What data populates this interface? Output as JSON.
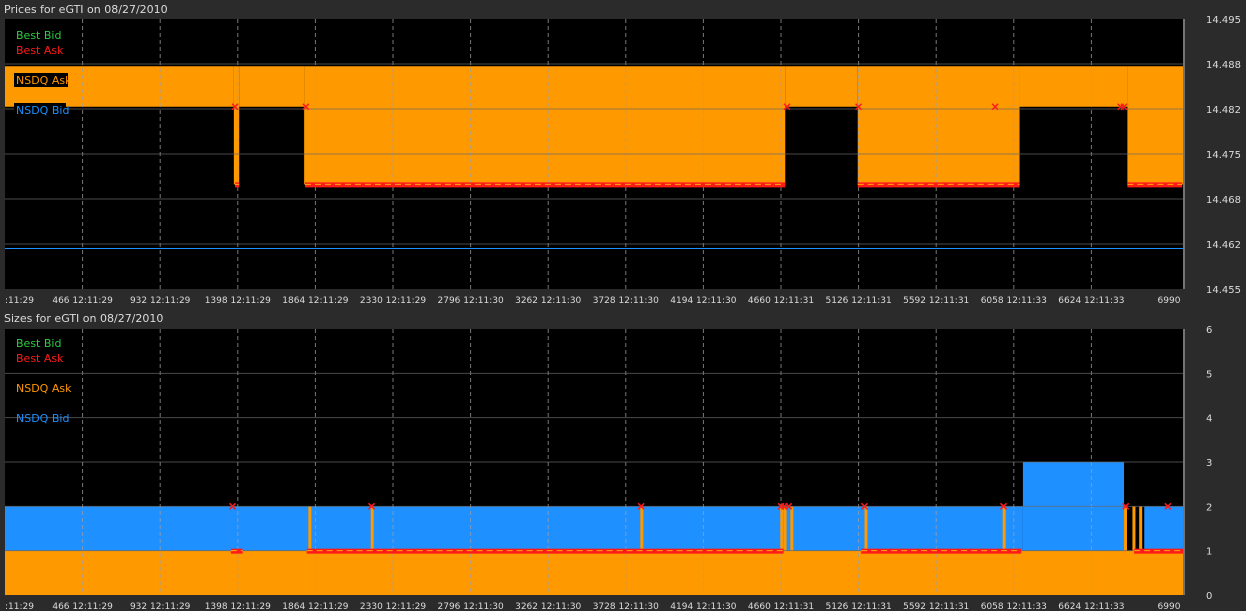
{
  "colors": {
    "background": "#2b2b2b",
    "plot_bg": "#000000",
    "best_bid": "#2ecc40",
    "best_ask": "#ff1a1a",
    "nsdq_ask": "#ff9900",
    "nsdq_bid": "#1e90ff",
    "grid": "#808080",
    "text": "#dcdcdc"
  },
  "chart_data": [
    {
      "type": "area",
      "title": "Prices for  eGTI  on  08/27/2010",
      "legend_position": "top-left",
      "legend": [
        "Best Bid",
        "Best Ask",
        "NSDQ Ask",
        "NSDQ Bid"
      ],
      "x_tick_labels": [
        ":11:29",
        "466 12:11:29",
        "932 12:11:29",
        "1398 12:11:29",
        "1864 12:11:29",
        "2330 12:11:29",
        "2796 12:11:30",
        "3262 12:11:30",
        "3728 12:11:30",
        "4194 12:11:30",
        "4660 12:11:31",
        "5126 12:11:31",
        "5592 12:11:31",
        "6058 12:11:33",
        "6624 12:11:33",
        "6990"
      ],
      "y_tick_labels": [
        "14.495",
        "14.488",
        "14.482",
        "14.475",
        "14.468",
        "14.462",
        "14.455"
      ],
      "xlim": [
        0,
        6990
      ],
      "ylim": [
        14.455,
        14.495
      ],
      "grid": true,
      "nsdq_ask_level": 14.488,
      "nsdq_bid_segments": [
        {
          "x0": 0,
          "x1": 1358,
          "y": 14.482
        },
        {
          "x0": 1358,
          "x1": 1390,
          "y": 14.4705
        },
        {
          "x0": 1390,
          "x1": 1775,
          "y": 14.482
        },
        {
          "x0": 1775,
          "x1": 4630,
          "y": 14.4705
        },
        {
          "x0": 4630,
          "x1": 5060,
          "y": 14.482
        },
        {
          "x0": 5060,
          "x1": 6020,
          "y": 14.4705
        },
        {
          "x0": 6020,
          "x1": 6660,
          "y": 14.482
        },
        {
          "x0": 6660,
          "x1": 6990,
          "y": 14.4705
        }
      ],
      "best_bid_line": 14.461,
      "best_ask_markers": [
        1365,
        1785,
        4640,
        5065,
        5875,
        6620,
        6640
      ],
      "best_ask_runs": [
        {
          "x0": 1365,
          "x1": 1390,
          "y": 14.4705
        },
        {
          "x0": 1780,
          "x1": 4630,
          "y": 14.4705
        },
        {
          "x0": 5060,
          "x1": 6020,
          "y": 14.4705
        },
        {
          "x0": 6660,
          "x1": 6985,
          "y": 14.4705
        }
      ]
    },
    {
      "type": "area",
      "title": "Sizes for  eGTI  on  08/27/2010",
      "legend_position": "top-left",
      "legend": [
        "Best Bid",
        "Best Ask",
        "NSDQ Ask",
        "NSDQ Bid"
      ],
      "x_tick_labels": [
        ":11:29",
        "466 12:11:29",
        "932 12:11:29",
        "1398 12:11:29",
        "1864 12:11:29",
        "2330 12:11:29",
        "2796 12:11:30",
        "3262 12:11:30",
        "3728 12:11:30",
        "4194 12:11:30",
        "4660 12:11:31",
        "5126 12:11:31",
        "5592 12:11:31",
        "6058 12:11:33",
        "6624 12:11:33",
        "6990"
      ],
      "y_tick_labels": [
        "6",
        "5",
        "4",
        "3",
        "2",
        "1",
        "0"
      ],
      "xlim": [
        0,
        6990
      ],
      "ylim": [
        0,
        6
      ],
      "grid": true,
      "nsdq_ask_size": 1,
      "nsdq_bid_segments": [
        {
          "x0": 0,
          "x1": 6040,
          "y": 2
        },
        {
          "x0": 6040,
          "x1": 6640,
          "y": 3
        },
        {
          "x0": 6640,
          "x1": 6760,
          "y": 1
        },
        {
          "x0": 6760,
          "x1": 6990,
          "y": 2
        }
      ],
      "orange_spikes": [
        1800,
        2170,
        3770,
        4600,
        4620,
        4660,
        5100,
        5920,
        6640,
        6690,
        6730
      ],
      "best_ask_markers": [
        1350,
        2175,
        3775,
        4605,
        4625,
        4650,
        5100,
        5925,
        6650,
        6900
      ],
      "best_ask_runs": [
        {
          "x0": 1340,
          "x1": 1410,
          "y": 1
        },
        {
          "x0": 1790,
          "x1": 4620,
          "y": 1
        },
        {
          "x0": 5080,
          "x1": 6030,
          "y": 1
        },
        {
          "x0": 6700,
          "x1": 6990,
          "y": 1
        }
      ]
    }
  ]
}
